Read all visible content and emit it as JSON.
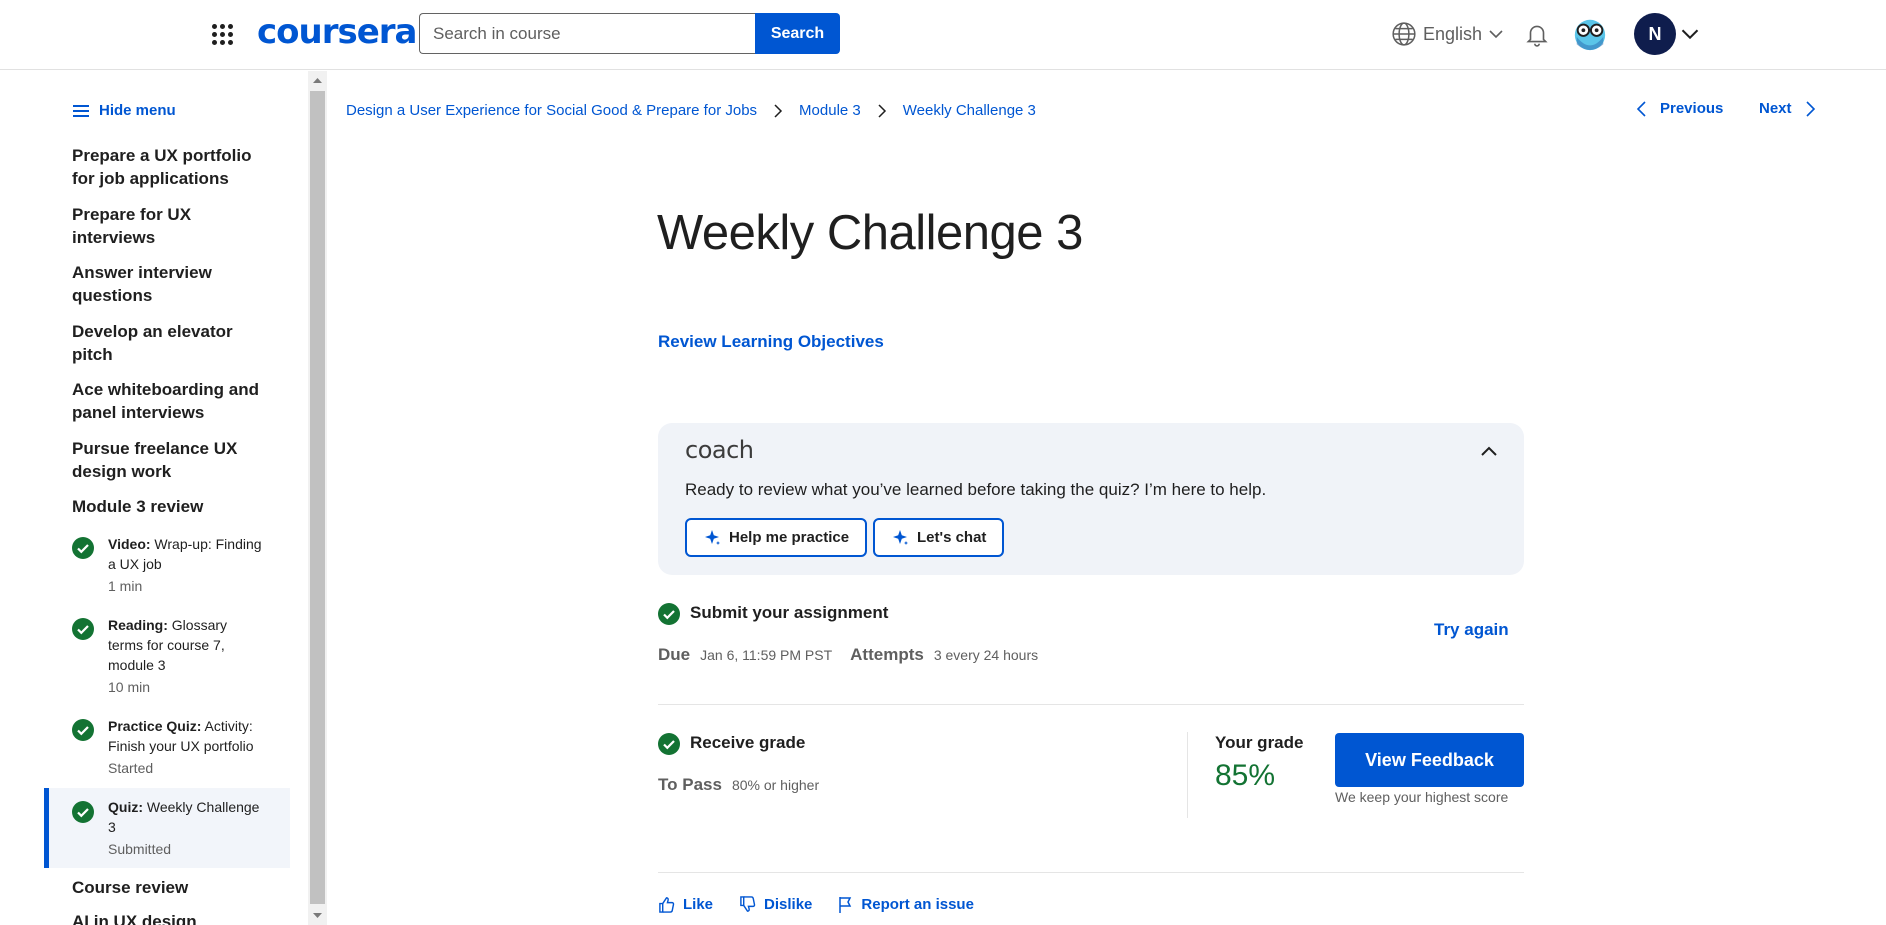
{
  "header": {
    "logo": "coursera",
    "search_placeholder": "Search in course",
    "search_button": "Search",
    "language": "English",
    "user_initial": "N"
  },
  "sidebar": {
    "hide_menu": "Hide menu",
    "lessons_top": [
      "Prepare a UX portfolio for job applications",
      "Prepare for UX interviews",
      "Answer interview questions",
      "Develop an elevator pitch",
      "Ace whiteboarding and panel interviews",
      "Pursue freelance UX design work",
      "Module 3 review"
    ],
    "items": [
      {
        "type": "Video:",
        "title": "Wrap-up: Finding a UX job",
        "meta": "1 min"
      },
      {
        "type": "Reading:",
        "title": "Glossary terms for course 7, module 3",
        "meta": "10 min"
      },
      {
        "type": "Practice Quiz:",
        "title": "Activity: Finish your UX portfolio",
        "meta": "Started"
      },
      {
        "type": "Quiz:",
        "title": "Weekly Challenge 3",
        "meta": "Submitted"
      }
    ],
    "lessons_bottom": [
      "Course review",
      "AI in UX design"
    ]
  },
  "breadcrumb": {
    "course": "Design a User Experience for Social Good & Prepare for Jobs",
    "module": "Module 3",
    "current": "Weekly Challenge 3"
  },
  "nav": {
    "previous": "Previous",
    "next": "Next"
  },
  "main": {
    "title": "Weekly Challenge 3",
    "review_link": "Review Learning Objectives"
  },
  "coach": {
    "brand": "coach",
    "prompt": "Ready to review what you’ve learned before taking the quiz? I’m here to help.",
    "button_practice": "Help me practice",
    "button_chat": "Let's chat"
  },
  "assignment": {
    "submit_title": "Submit your assignment",
    "try_again": "Try again",
    "due_label": "Due",
    "due_value": "Jan 6, 11:59 PM PST",
    "attempts_label": "Attempts",
    "attempts_value": "3 every 24 hours",
    "receive_title": "Receive grade",
    "pass_label": "To Pass",
    "pass_value": "80% or higher",
    "grade_label": "Your grade",
    "grade_value": "85%",
    "view_feedback": "View Feedback",
    "keep_note": "We keep your highest score"
  },
  "footer": {
    "like": "Like",
    "dislike": "Dislike",
    "report": "Report an issue"
  },
  "colors": {
    "brand_blue": "#0056d2",
    "success_green": "#137333",
    "coach_bg": "#f0f3f8",
    "avatar_bg": "#0f1d4d"
  }
}
